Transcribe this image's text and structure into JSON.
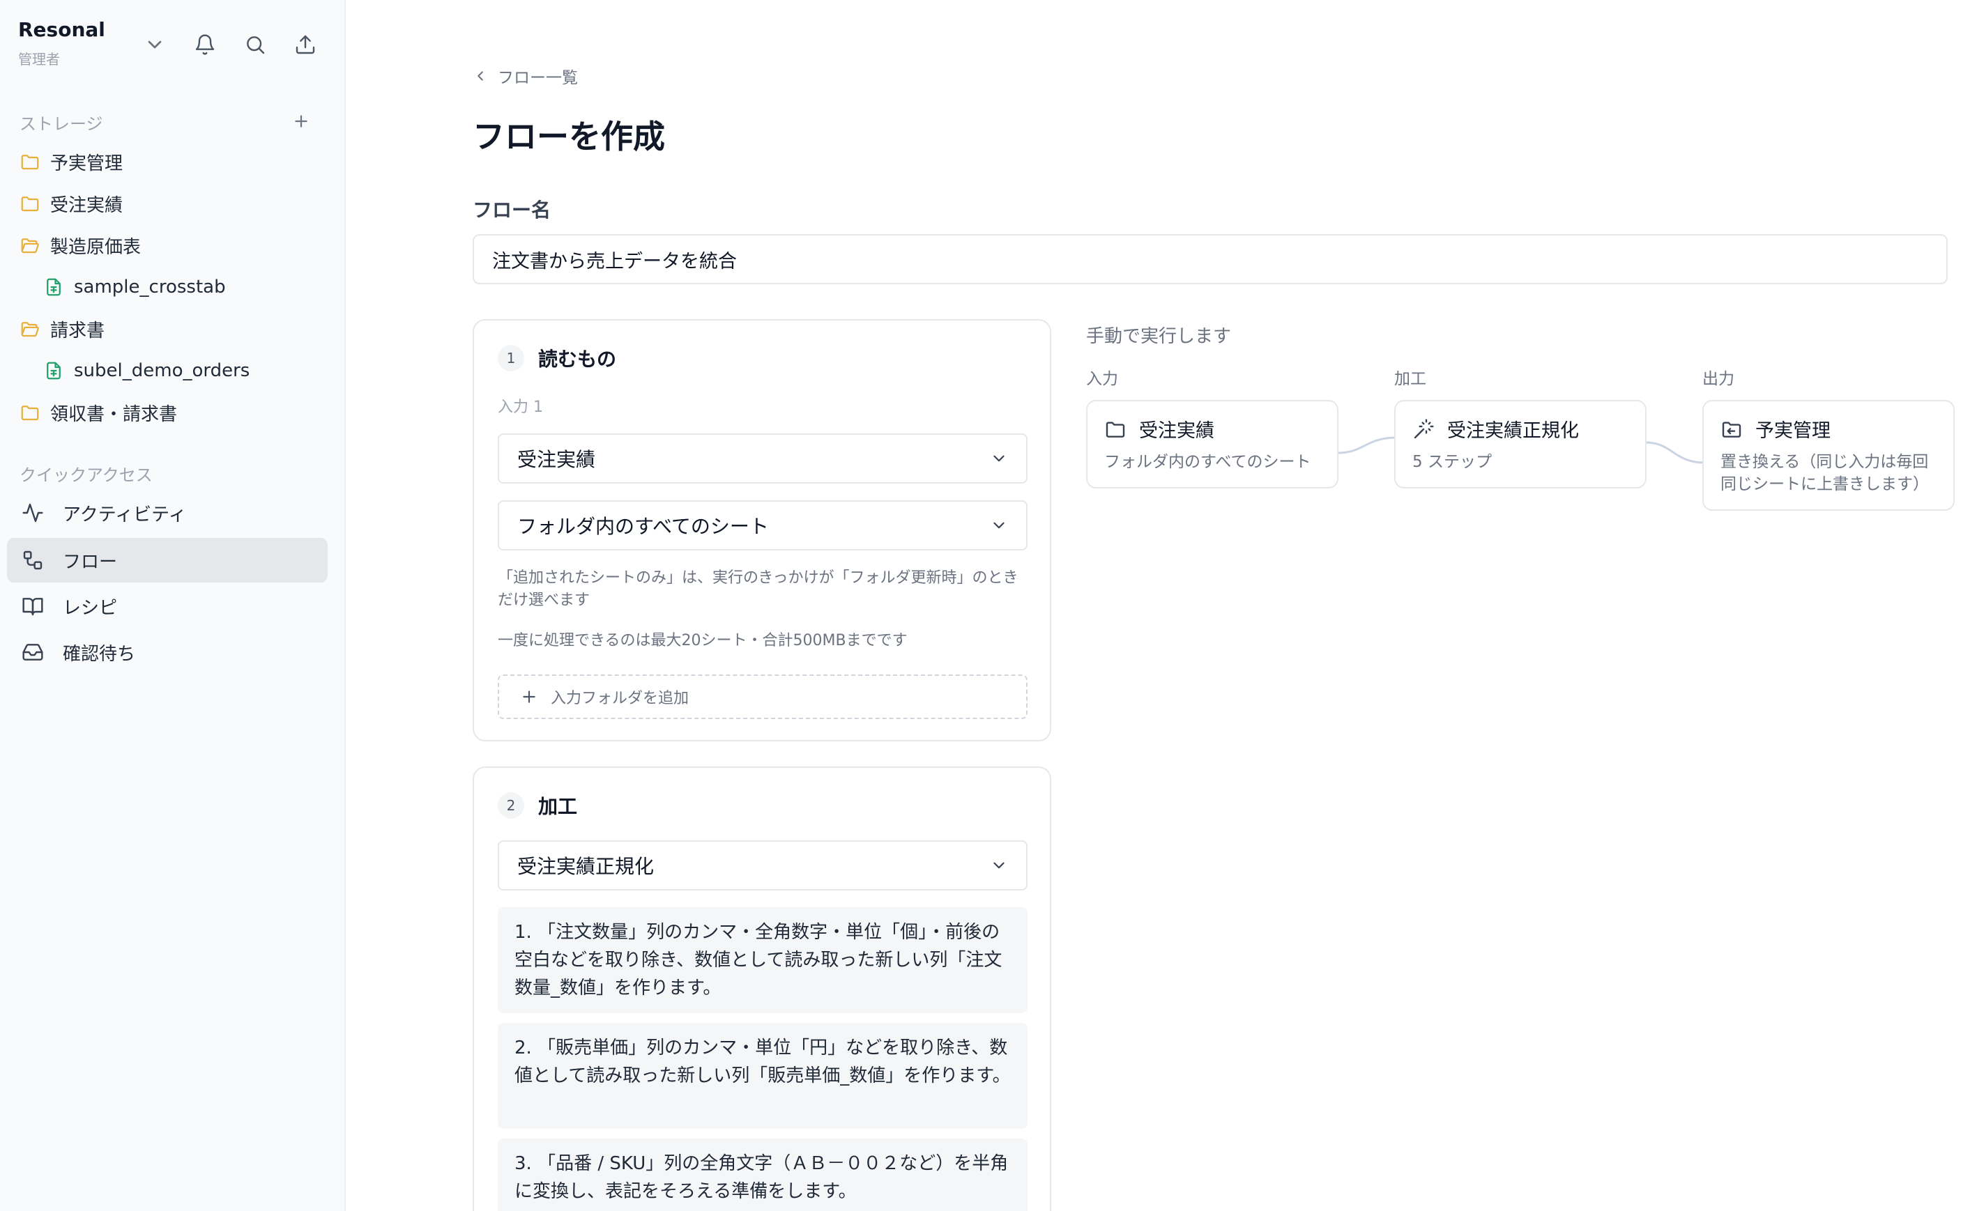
{
  "app": {
    "name": "Resonal",
    "role": "管理者"
  },
  "sidebar": {
    "storage_label": "ストレージ",
    "tree": [
      {
        "label": "予実管理",
        "type": "folder"
      },
      {
        "label": "受注実績",
        "type": "folder"
      },
      {
        "label": "製造原価表",
        "type": "folder-open"
      },
      {
        "label": "sample_crosstab",
        "type": "sheet"
      },
      {
        "label": "請求書",
        "type": "folder-open"
      },
      {
        "label": "subel_demo_orders",
        "type": "sheet"
      },
      {
        "label": "領収書・請求書",
        "type": "folder"
      }
    ],
    "quick_label": "クイックアクセス",
    "nav": [
      {
        "label": "アクティビティ",
        "icon": "activity-icon"
      },
      {
        "label": "フロー",
        "icon": "flow-icon",
        "active": true
      },
      {
        "label": "レシピ",
        "icon": "book-icon"
      },
      {
        "label": "確認待ち",
        "icon": "inbox-icon"
      }
    ]
  },
  "main": {
    "breadcrumb": "フロー一覧",
    "title": "フローを作成",
    "flow_name_label": "フロー名",
    "flow_name_value": "注文書から売上データを統合",
    "step1": {
      "number": "1",
      "title": "読むもの",
      "input_label": "入力 1",
      "folder_select": "受注実績",
      "sheet_select": "フォルダ内のすべてのシート",
      "hint1": "「追加されたシートのみ」は、実行のきっかけが「フォルダ更新時」のときだけ選べます",
      "hint2": "一度に処理できるのは最大20シート・合計500MBまでです",
      "add_folder": "入力フォルダを追加"
    },
    "step2": {
      "number": "2",
      "title": "加工",
      "recipe_select": "受注実績正規化",
      "operations": [
        "1. 「注文数量」列のカンマ・全角数字・単位「個」・前後の空白などを取り除き、数値として読み取った新しい列「注文数量_数値」を作ります。",
        "2. 「販売単価」列のカンマ・単位「円」などを取り除き、数値として読み取った新しい列「販売単価_数値」を作ります。",
        "3. 「品番 / SKU」列の全角文字（ＡＢ－００２など）を半角に変換し、表記をそろえる準備をします。"
      ]
    }
  },
  "preview": {
    "exec_mode": "手動で実行します",
    "columns": {
      "input": "入力",
      "process": "加工",
      "output": "出力"
    },
    "nodes": {
      "input": {
        "title": "受注実績",
        "sub": "フォルダ内のすべてのシート"
      },
      "process": {
        "title": "受注実績正規化",
        "sub": "5 ステップ"
      },
      "output": {
        "title": "予実管理",
        "sub": "置き換える（同じ入力は毎回同じシートに上書きします）"
      }
    }
  },
  "colors": {
    "folder": "#e7b03a",
    "sheet": "#22a06b",
    "active_nav": "#e5e7eb",
    "sidebar_bg": "#f9fafb"
  }
}
